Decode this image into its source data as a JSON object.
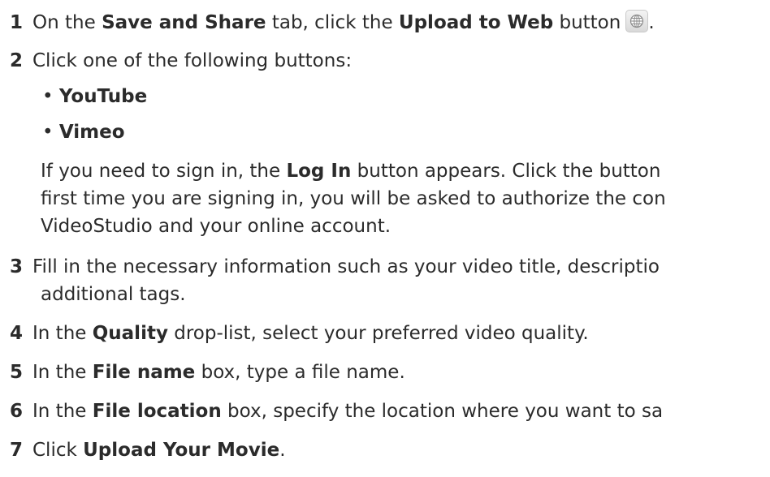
{
  "steps": {
    "s1": {
      "number": "1",
      "pre": "On the ",
      "bold1": "Save and Share",
      "mid": " tab, click the ",
      "bold2": "Upload to Web",
      "post": " button",
      "tail": ".",
      "icon": "globe-icon"
    },
    "s2": {
      "number": "2",
      "text": "Click one of the following buttons:",
      "bullets": [
        "YouTube",
        "Vimeo"
      ],
      "bullet_char": "•",
      "note": {
        "line1_pre": "If you need to sign in, the ",
        "line1_bold": "Log In",
        "line1_post": " button appears. Click the button",
        "line2": "first time you are signing in, you will be asked to authorize the con",
        "line3": "VideoStudio and your online account."
      }
    },
    "s3": {
      "number": "3",
      "line1": "Fill in the necessary information such as your video title, descriptio",
      "line2": "additional tags."
    },
    "s4": {
      "number": "4",
      "pre": "In the ",
      "bold": "Quality",
      "post": " drop-list, select your preferred video quality."
    },
    "s5": {
      "number": "5",
      "pre": "In the ",
      "bold": "File name",
      "post": " box, type a file name."
    },
    "s6": {
      "number": "6",
      "pre": "In the ",
      "bold": "File location",
      "post": " box, specify the location where you want to sa"
    },
    "s7": {
      "number": "7",
      "pre": "Click ",
      "bold": "Upload Your Movie",
      "post": "."
    }
  }
}
